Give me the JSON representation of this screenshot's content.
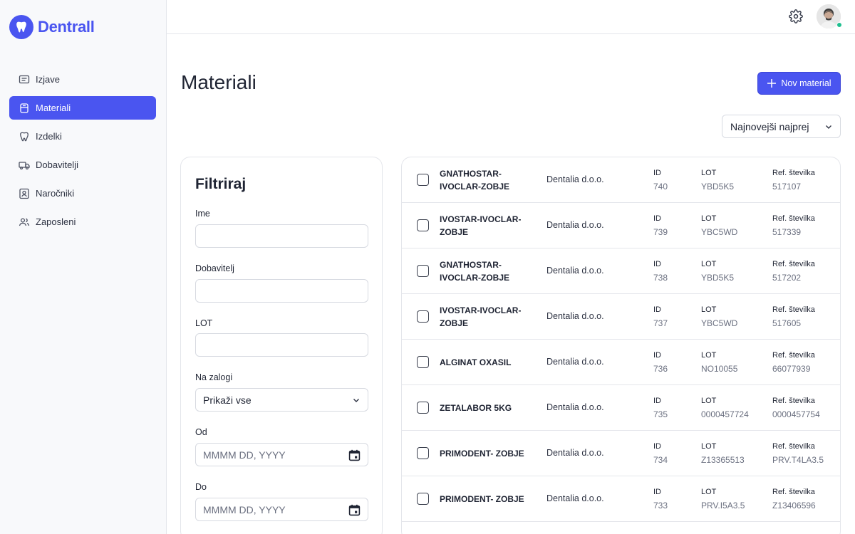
{
  "brand": {
    "name": "Dentrall",
    "accent": "#4a55f0"
  },
  "sidebar": {
    "items": [
      {
        "label": "Izjave",
        "icon": "message-icon",
        "active": false
      },
      {
        "label": "Materiali",
        "icon": "box-icon",
        "active": true
      },
      {
        "label": "Izdelki",
        "icon": "tooth-icon",
        "active": false
      },
      {
        "label": "Dobavitelji",
        "icon": "truck-icon",
        "active": false
      },
      {
        "label": "Naročniki",
        "icon": "contact-card-icon",
        "active": false
      },
      {
        "label": "Zaposleni",
        "icon": "users-icon",
        "active": false
      }
    ]
  },
  "topbar": {
    "settings_icon": "gear-icon",
    "avatar": "user-avatar",
    "status": "online"
  },
  "header": {
    "title": "Materiali",
    "new_button": "Nov material",
    "sort": {
      "selected": "Najnovejši najprej"
    }
  },
  "filter": {
    "title": "Filtriraj",
    "fields": {
      "name_label": "Ime",
      "name_value": "",
      "supplier_label": "Dobavitelj",
      "supplier_value": "",
      "lot_label": "LOT",
      "lot_value": "",
      "stock_label": "Na zalogi",
      "stock_selected": "Prikaži vse",
      "from_label": "Od",
      "from_placeholder": "MMMM DD, YYYY",
      "to_label": "Do",
      "to_placeholder": "MMMM DD, YYYY"
    }
  },
  "list": {
    "col_id": "ID",
    "col_lot": "LOT",
    "col_ref": "Ref. številka",
    "rows": [
      {
        "name": "GNATHOSTAR-IVOCLAR-ZOBJE",
        "supplier": "Dentalia d.o.o.",
        "id": "740",
        "lot": "YBD5K5",
        "ref": "517107"
      },
      {
        "name": "IVOSTAR-IVOCLAR-ZOBJE",
        "supplier": "Dentalia d.o.o.",
        "id": "739",
        "lot": "YBC5WD",
        "ref": "517339"
      },
      {
        "name": "GNATHOSTAR-IVOCLAR-ZOBJE",
        "supplier": "Dentalia d.o.o.",
        "id": "738",
        "lot": "YBD5K5",
        "ref": "517202"
      },
      {
        "name": "IVOSTAR-IVOCLAR-ZOBJE",
        "supplier": "Dentalia d.o.o.",
        "id": "737",
        "lot": "YBC5WD",
        "ref": "517605"
      },
      {
        "name": "ALGINAT OXASIL",
        "supplier": "Dentalia d.o.o.",
        "id": "736",
        "lot": "NO10055",
        "ref": "66077939"
      },
      {
        "name": "ZETALABOR 5KG",
        "supplier": "Dentalia d.o.o.",
        "id": "735",
        "lot": "0000457724",
        "ref": "0000457754"
      },
      {
        "name": "PRIMODENT- ZOBJE",
        "supplier": "Dentalia d.o.o.",
        "id": "734",
        "lot": "Z13365513",
        "ref": "PRV.T4LA3.5"
      },
      {
        "name": "PRIMODENT- ZOBJE",
        "supplier": "Dentalia d.o.o.",
        "id": "733",
        "lot": "PRV.I5A3.5",
        "ref": "Z13406596"
      }
    ]
  }
}
